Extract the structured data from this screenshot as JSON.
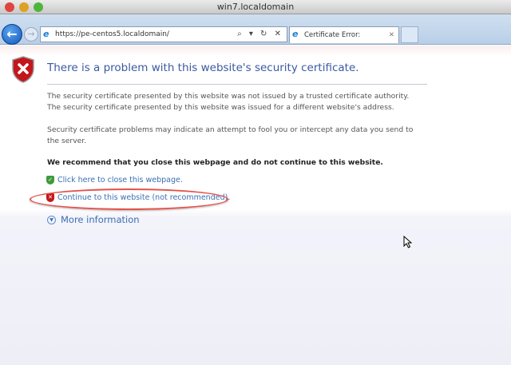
{
  "window": {
    "title": "win7.localdomain"
  },
  "browser": {
    "url": "https://pe-centos5.localdomain/",
    "tab_title": "Certificate Error: Navigatio...",
    "addr_buttons": "⌕ ▾ ↻ ✕",
    "tab_close": "✕"
  },
  "page": {
    "heading": "There is a problem with this website's security certificate.",
    "para1_line1": "The security certificate presented by this website was not issued by a trusted certificate authority.",
    "para1_line2": "The security certificate presented by this website was issued for a different website's address.",
    "para2": "Security certificate problems may indicate an attempt to fool you or intercept any data you send to the server.",
    "recommend": "We recommend that you close this webpage and do not continue to this website.",
    "close_link": "Click here to close this webpage.",
    "continue_link": "Continue to this website (not recommended).",
    "more_info": "More information"
  },
  "colors": {
    "link": "#3a6fb5",
    "heading": "#3a59a3",
    "annotation": "#e5534b"
  }
}
